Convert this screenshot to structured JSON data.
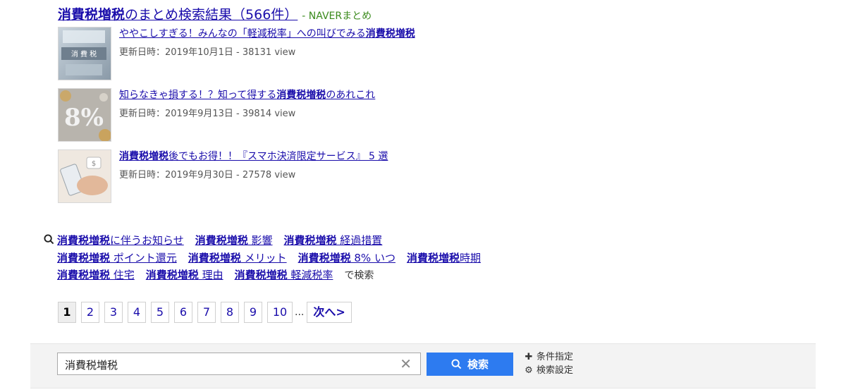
{
  "matome": {
    "title_bold": "消費税増税",
    "title_rest": "のまとめ検索結果（566件）",
    "source": "- NAVERまとめ",
    "articles": [
      {
        "title_pre": "ややこしすぎる！みんなの「軽減税率」への叫びでみる",
        "title_bold": "消費税増税",
        "title_post": "",
        "meta": "更新日時：2019年10月1日 - 38131 view",
        "thumb": "tax-sign-thumbnail"
      },
      {
        "title_pre": "知らなきゃ損する！？知って得する",
        "title_bold": "消費税増税",
        "title_post": "のあれこれ",
        "meta": "更新日時：2019年9月13日 - 39814 view",
        "thumb": "8-percent-thumbnail"
      },
      {
        "title_pre": "",
        "title_bold": "消費税増税",
        "title_post": "後でもお得！！『スマホ決済限定サービス』 5 選",
        "meta": "更新日時：2019年9月30日 - 27578 view",
        "thumb": "smartphone-payment-thumbnail"
      }
    ]
  },
  "related": {
    "items": [
      {
        "bold": "消費税増税",
        "rest": "に伴うお知らせ"
      },
      {
        "bold": "消費税増税",
        "rest": " 影響"
      },
      {
        "bold": "消費税増税",
        "rest": " 経過措置"
      },
      {
        "bold": "消費税増税",
        "rest": " ポイント還元"
      },
      {
        "bold": "消費税増税",
        "rest": " メリット"
      },
      {
        "bold": "消費税増税",
        "rest": " 8% いつ"
      },
      {
        "bold": "消費税増税",
        "rest": "時期"
      },
      {
        "bold": "消費税増税",
        "rest": " 住宅"
      },
      {
        "bold": "消費税増税",
        "rest": " 理由"
      },
      {
        "bold": "消費税増税",
        "rest": " 軽減税率"
      }
    ],
    "suffix": "で検索"
  },
  "pagination": {
    "current": "1",
    "pages": [
      "2",
      "3",
      "4",
      "5",
      "6",
      "7",
      "8",
      "9",
      "10"
    ],
    "ellipsis": "...",
    "next": "次へ>"
  },
  "search": {
    "value": "消費税増税",
    "clear": "✕",
    "button": "検索",
    "options": [
      "条件指定",
      "検索設定"
    ]
  },
  "colors": {
    "link": "#1a0dab",
    "source": "#3a8a1c",
    "search_button": "#2d7bf0"
  }
}
